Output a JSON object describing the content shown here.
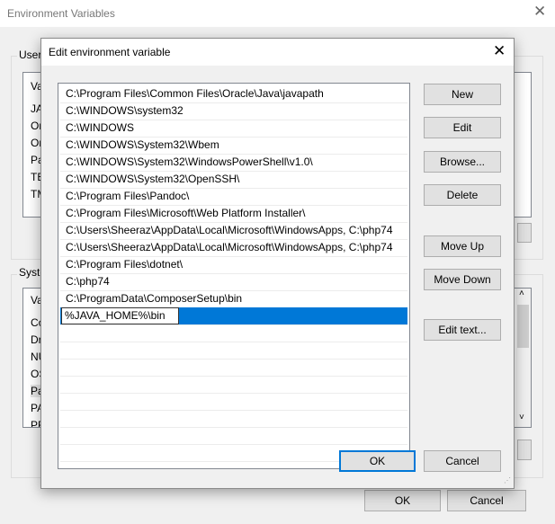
{
  "outer": {
    "title": "Environment Variables",
    "user_group": "User",
    "user_partials": [
      "Va",
      "JA",
      "Or",
      "Or",
      "Pa",
      "TE",
      "TM"
    ],
    "system_group": "Syste",
    "system_partials": [
      "Va",
      "Co",
      "Dr",
      "NU",
      "OS",
      "Pa",
      "PA",
      "PR"
    ],
    "ok": "OK",
    "cancel": "Cancel"
  },
  "dialog": {
    "title": "Edit environment variable",
    "entries": [
      "C:\\Program Files\\Common Files\\Oracle\\Java\\javapath",
      "C:\\WINDOWS\\system32",
      "C:\\WINDOWS",
      "C:\\WINDOWS\\System32\\Wbem",
      "C:\\WINDOWS\\System32\\WindowsPowerShell\\v1.0\\",
      "C:\\WINDOWS\\System32\\OpenSSH\\",
      "C:\\Program Files\\Pandoc\\",
      "C:\\Program Files\\Microsoft\\Web Platform Installer\\",
      "C:\\Users\\Sheeraz\\AppData\\Local\\Microsoft\\WindowsApps, C:\\php74",
      "C:\\Users\\Sheeraz\\AppData\\Local\\Microsoft\\WindowsApps, C:\\php74",
      "C:\\Program Files\\dotnet\\",
      "C:\\php74",
      "C:\\ProgramData\\ComposerSetup\\bin"
    ],
    "editing_value": "%JAVA_HOME%\\bin",
    "buttons": {
      "new": "New",
      "edit": "Edit",
      "browse": "Browse...",
      "delete": "Delete",
      "move_up": "Move Up",
      "move_down": "Move Down",
      "edit_text": "Edit text...",
      "ok": "OK",
      "cancel": "Cancel"
    },
    "selection_color": "#0078d7"
  }
}
